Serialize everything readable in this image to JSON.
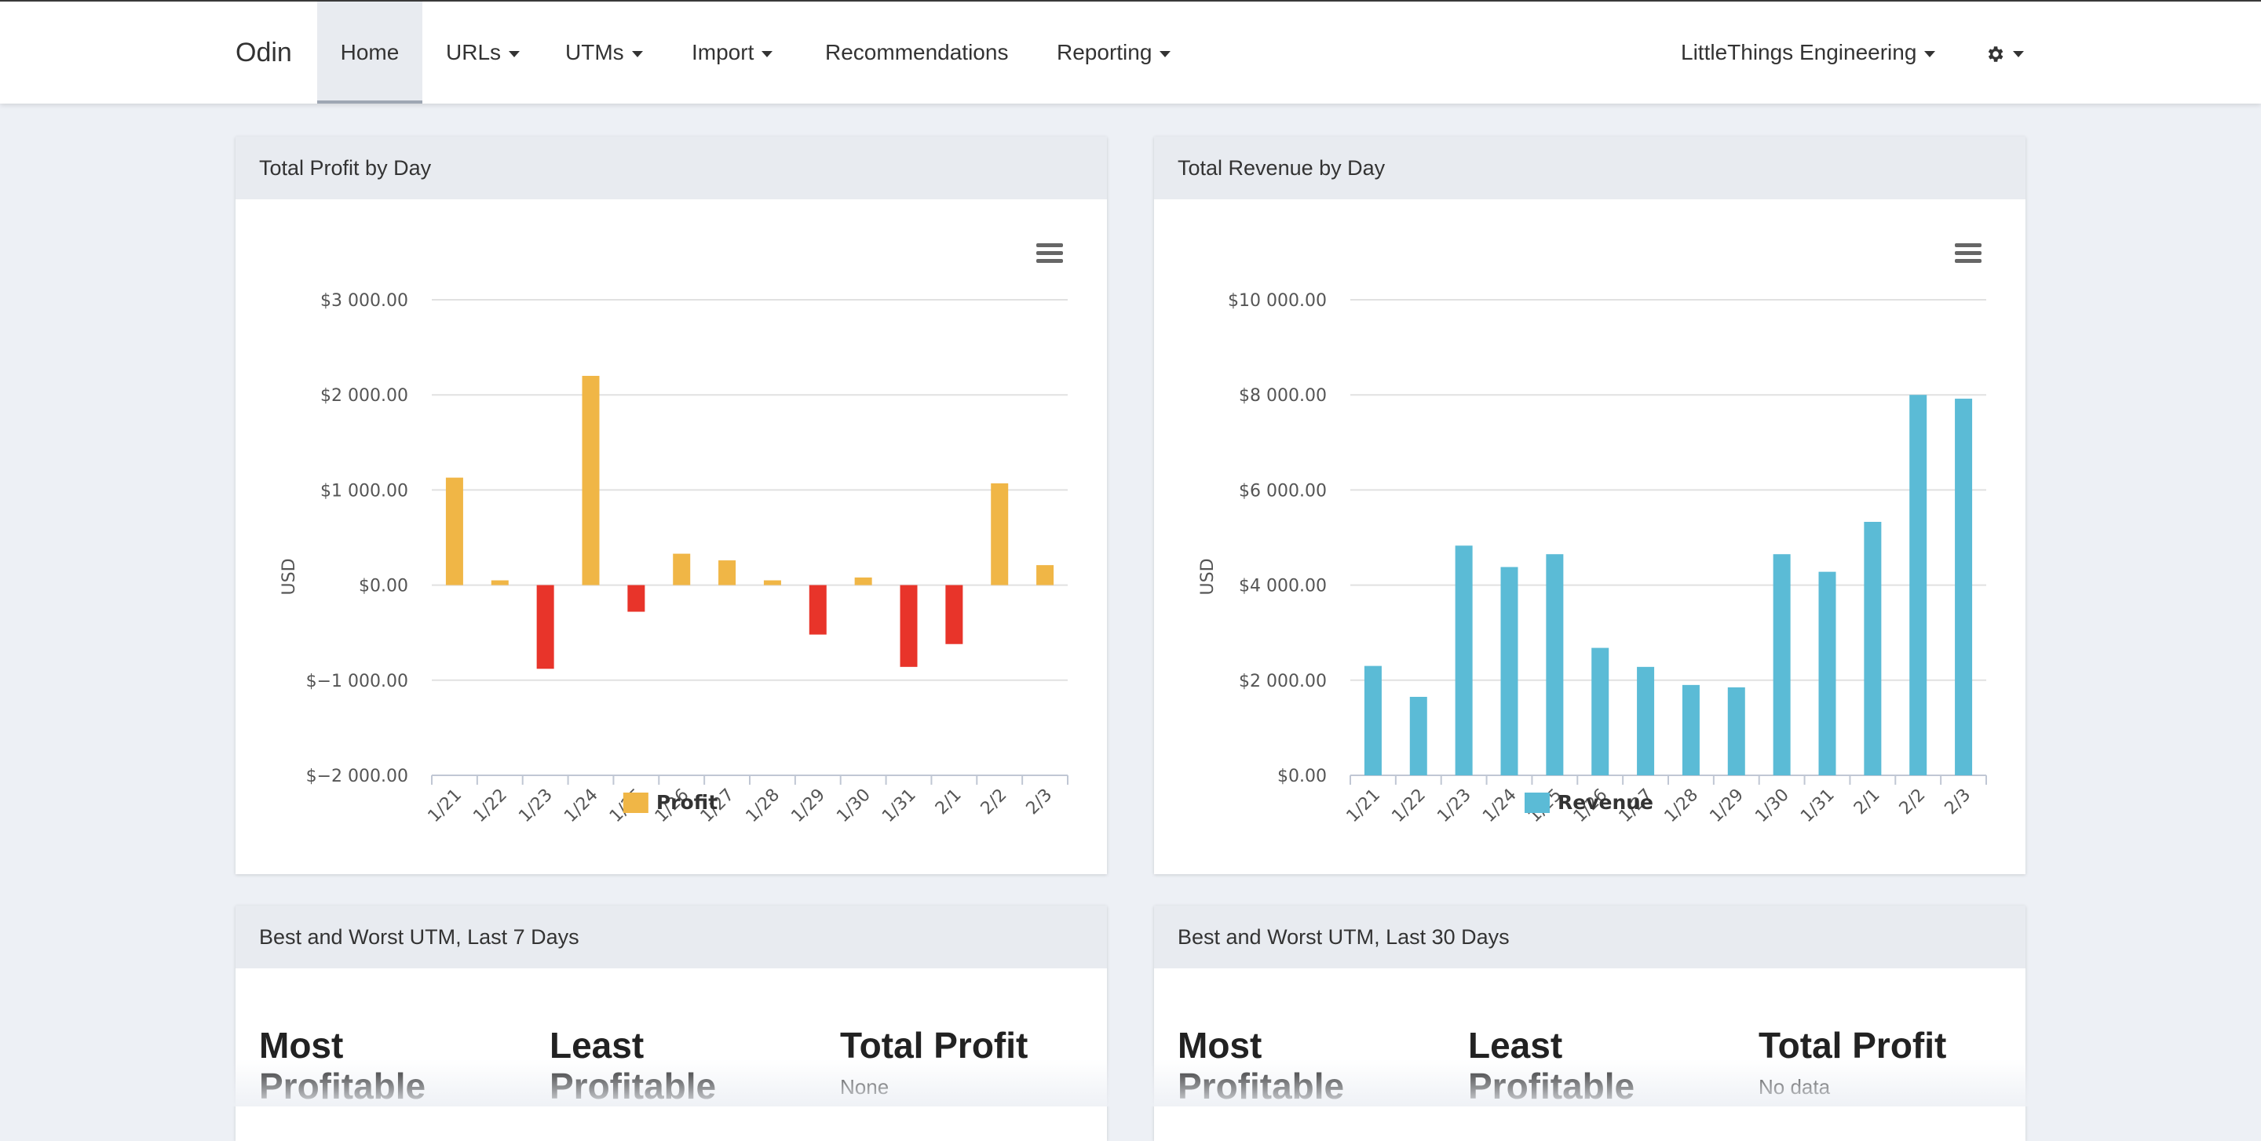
{
  "nav": {
    "brand": "Odin",
    "items": [
      {
        "label": "Home",
        "active": true,
        "dropdown": false
      },
      {
        "label": "URLs",
        "dropdown": true
      },
      {
        "label": "UTMs",
        "dropdown": true
      },
      {
        "label": "Import",
        "dropdown": true
      },
      {
        "label": "Recommendations",
        "dropdown": false
      },
      {
        "label": "Reporting",
        "dropdown": true
      }
    ],
    "account": "LittleThings Engineering",
    "settings_icon": "gear-icon"
  },
  "cards": {
    "profit": {
      "title": "Total Profit by Day"
    },
    "revenue": {
      "title": "Total Revenue by Day"
    },
    "utm7": {
      "title": "Best and Worst UTM, Last 7 Days",
      "col1": "Most Profitable",
      "col2": "Least Profitable",
      "col3": "Total Profit",
      "total_value": "None"
    },
    "utm30": {
      "title": "Best and Worst UTM, Last 30 Days",
      "col1": "Most Profitable",
      "col2": "Least Profitable",
      "col3": "Total Profit",
      "total_value": "No data"
    }
  },
  "colors": {
    "profit_positive": "#f0b646",
    "profit_negative": "#e8342a",
    "revenue": "#5bbbd6"
  },
  "chart_data": [
    {
      "type": "bar",
      "categories": [
        "1/21",
        "1/22",
        "1/23",
        "1/24",
        "1/25",
        "1/26",
        "1/27",
        "1/28",
        "1/29",
        "1/30",
        "1/31",
        "2/1",
        "2/2",
        "2/3"
      ],
      "series": [
        {
          "name": "Profit",
          "values": [
            1130,
            50,
            -880,
            2200,
            -280,
            330,
            260,
            50,
            -520,
            80,
            -860,
            -620,
            1070,
            210
          ]
        }
      ],
      "ylabel": "USD",
      "ylim": [
        -2000,
        3000
      ],
      "yticks": [
        "$−2 000.00",
        "$−1 000.00",
        "$0.00",
        "$1 000.00",
        "$2 000.00",
        "$3 000.00"
      ],
      "ytick_values": [
        -2000,
        -1000,
        0,
        1000,
        2000,
        3000
      ],
      "grid": true,
      "legend": "bottom"
    },
    {
      "type": "bar",
      "categories": [
        "1/21",
        "1/22",
        "1/23",
        "1/24",
        "1/25",
        "1/26",
        "1/27",
        "1/28",
        "1/29",
        "1/30",
        "1/31",
        "2/1",
        "2/2",
        "2/3"
      ],
      "series": [
        {
          "name": "Revenue",
          "values": [
            2300,
            1650,
            4830,
            4380,
            4650,
            2680,
            2280,
            1900,
            1850,
            4650,
            4280,
            5330,
            8000,
            7920
          ]
        }
      ],
      "ylabel": "USD",
      "ylim": [
        0,
        10000
      ],
      "yticks": [
        "$0.00",
        "$2 000.00",
        "$4 000.00",
        "$6 000.00",
        "$8 000.00",
        "$10 000.00"
      ],
      "ytick_values": [
        0,
        2000,
        4000,
        6000,
        8000,
        10000
      ],
      "grid": true,
      "legend": "bottom"
    }
  ]
}
